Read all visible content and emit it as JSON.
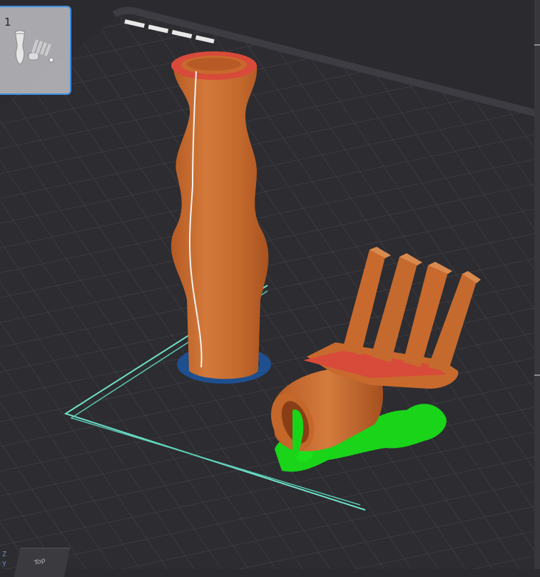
{
  "app": {
    "plate_index": "1",
    "view_cube_label": "Top",
    "axis_z": "Z",
    "axis_y": "Y"
  },
  "colors": {
    "bed": "#2b2b30",
    "grid": "#4a4a50",
    "wall_print": "#c8692d",
    "wall_highlight": "#d98a4f",
    "top_surface": "#d84a3a",
    "support": "#19d419",
    "brim": "#1e4f8f",
    "skirt": "#6fe0c8",
    "selection": "#3b8fe0"
  },
  "icons": [
    "plate-thumbnail-icon"
  ]
}
